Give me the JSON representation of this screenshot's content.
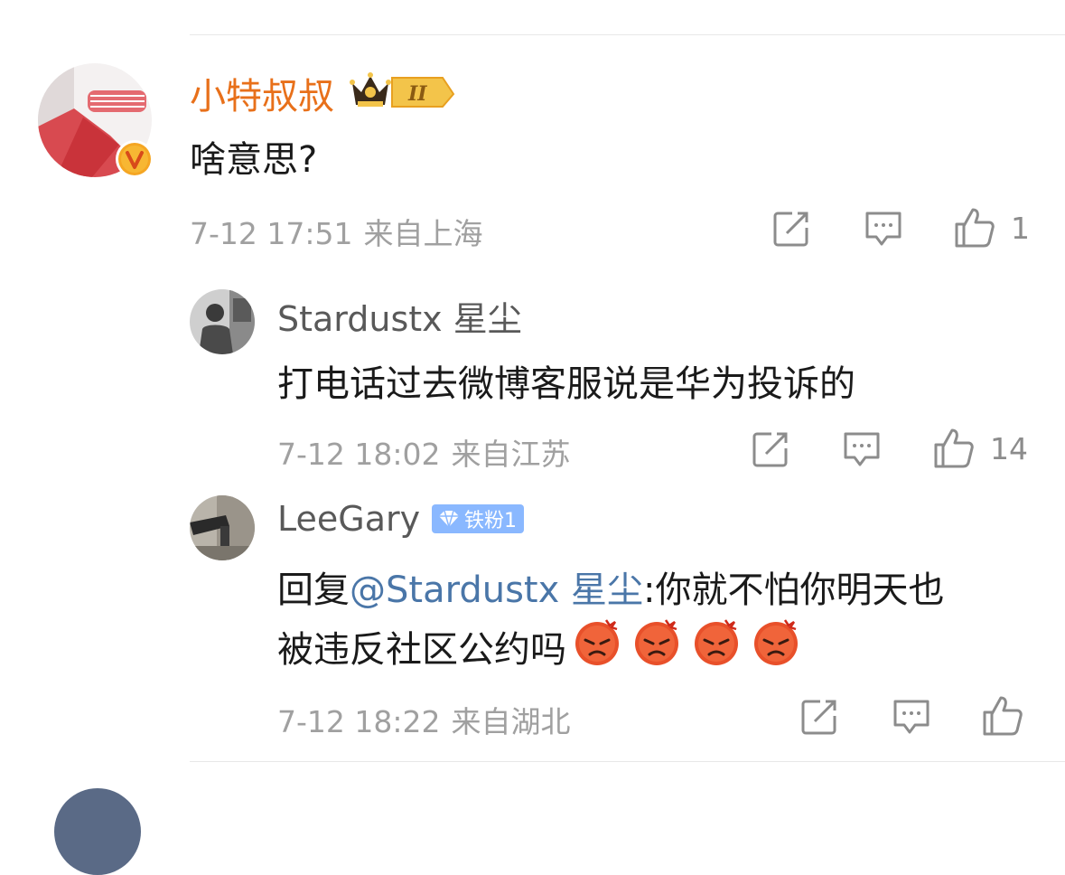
{
  "comments": [
    {
      "username": "小特叔叔",
      "username_color": "#e8701a",
      "text": "啥意思?",
      "time": "7-12 17:51",
      "location": "来自上海",
      "like_count": "1"
    },
    {
      "username": "Stardustx 星尘",
      "text": "打电话过去微博客服说是华为投诉的",
      "time": "7-12 18:02",
      "location": "来自江苏",
      "like_count": "14"
    },
    {
      "username": "LeeGary",
      "badge": "铁粉1",
      "reply_prefix": "回复",
      "mention": "@Stardustx 星尘",
      "text_line1": ":你就不怕你明天也",
      "text_line2": "被违反社区公约吗",
      "time": "7-12 18:22",
      "location": "来自湖北",
      "like_count": ""
    }
  ],
  "colors": {
    "accent_orange": "#e8701a",
    "mention_blue": "#4a76a8",
    "meta_gray": "#a0a0a0",
    "badge_blue": "#8ab8ff"
  },
  "icons": [
    "share-icon",
    "comment-icon",
    "like-icon",
    "vip-crown-icon",
    "verified-v-icon",
    "diamond-icon",
    "angry-emoji-icon"
  ]
}
